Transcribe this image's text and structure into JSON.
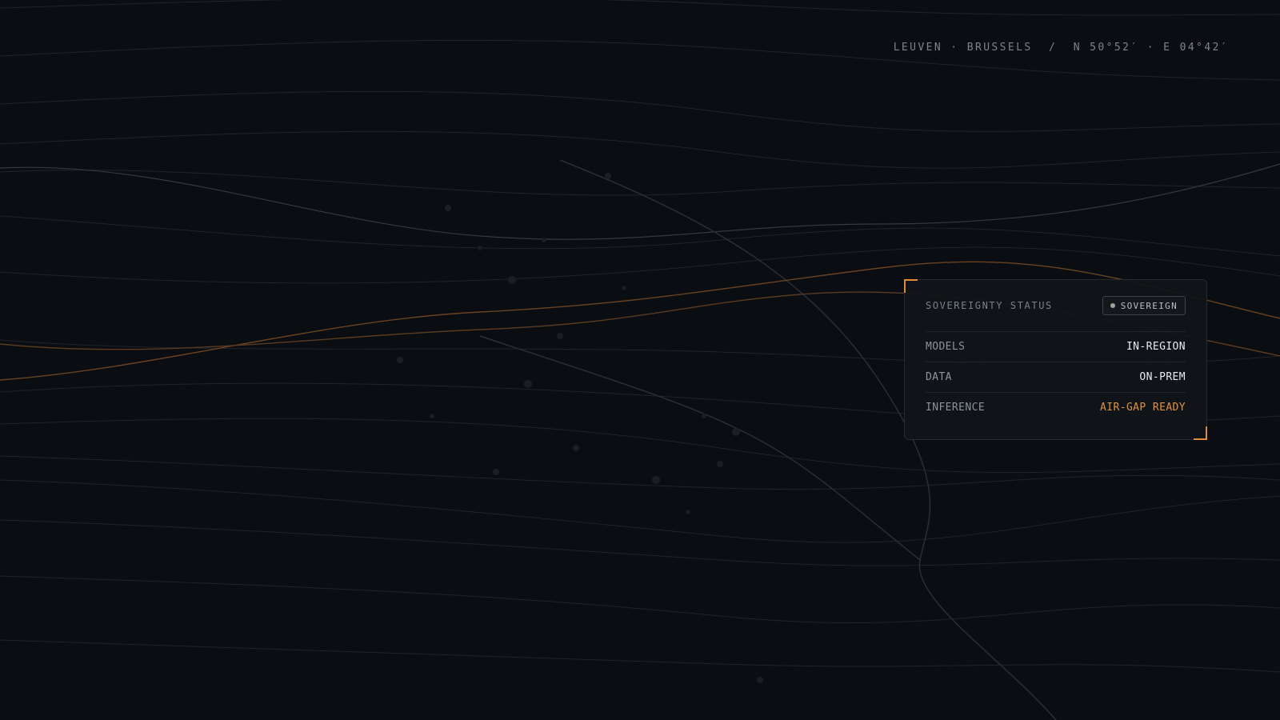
{
  "location": {
    "text": "LEUVEN · BRUSSELS  /  N 50°52′ · E 04°42′"
  },
  "panel": {
    "title": "SOVEREIGNTY STATUS",
    "badge": "SOVEREIGN",
    "rows": [
      {
        "key": "MODELS",
        "value": "IN-REGION",
        "color": "#e9ebee"
      },
      {
        "key": "DATA",
        "value": "ON-PREM",
        "color": "#e9ebee"
      },
      {
        "key": "INFERENCE",
        "value": "AIR-GAP READY",
        "color": "#e0913f"
      }
    ]
  },
  "colors": {
    "background": "#0a0d11",
    "accent": "#e08a3a",
    "line": "#2a2f36"
  }
}
